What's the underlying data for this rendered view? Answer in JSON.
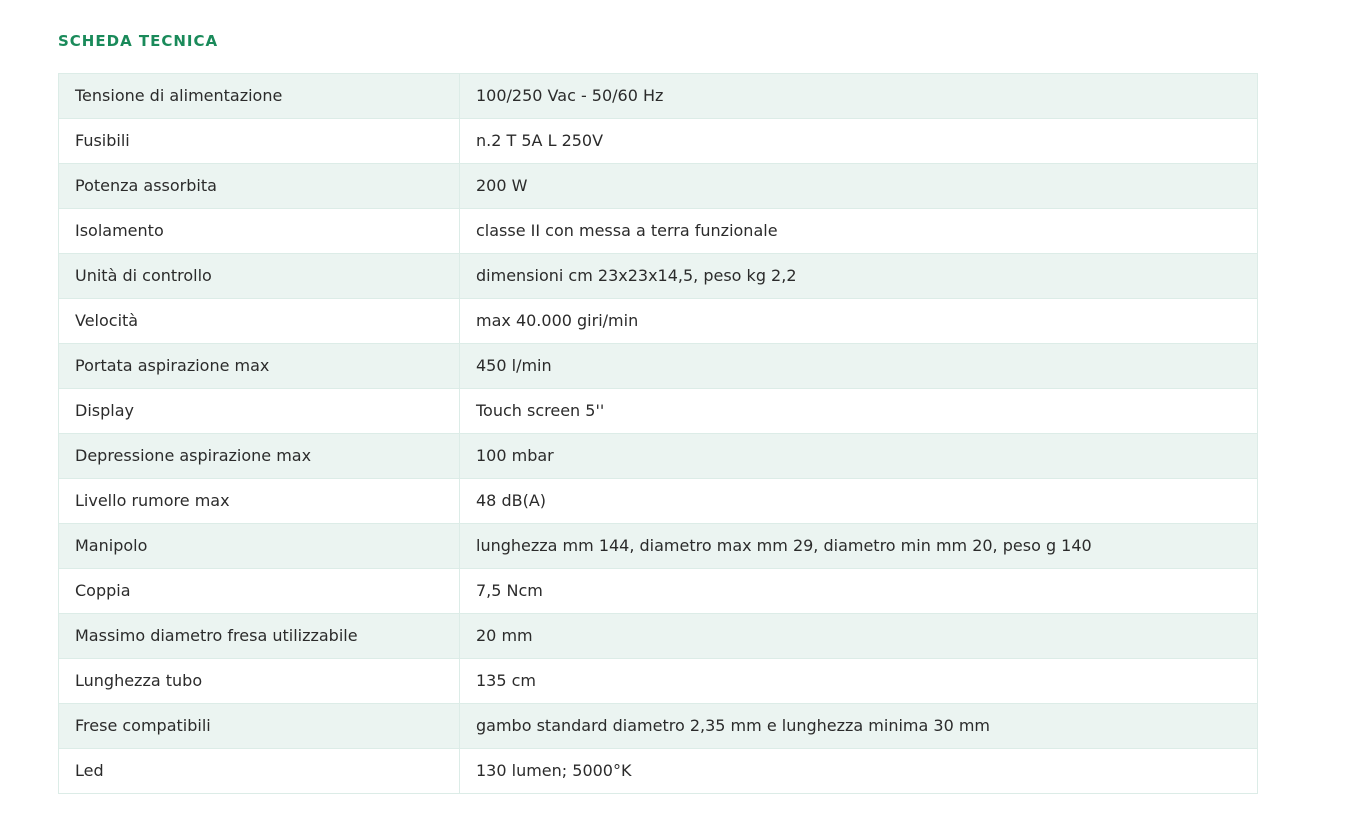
{
  "section": {
    "title": "SCHEDA TECNICA"
  },
  "specs": [
    {
      "label": "Tensione di alimentazione",
      "value": "100/250 Vac - 50/60 Hz"
    },
    {
      "label": "Fusibili",
      "value": "n.2 T 5A L 250V"
    },
    {
      "label": "Potenza assorbita",
      "value": "200 W"
    },
    {
      "label": "Isolamento",
      "value": "classe II con messa a terra funzionale"
    },
    {
      "label": "Unità di controllo",
      "value": "dimensioni cm 23x23x14,5, peso kg 2,2"
    },
    {
      "label": "Velocità",
      "value": "max 40.000 giri/min"
    },
    {
      "label": "Portata aspirazione max",
      "value": "450 l/min"
    },
    {
      "label": "Display",
      "value": "Touch screen 5''"
    },
    {
      "label": "Depressione aspirazione max",
      "value": "100 mbar"
    },
    {
      "label": "Livello rumore max",
      "value": "48 dB(A)"
    },
    {
      "label": "Manipolo",
      "value": "lunghezza mm 144, diametro max mm 29, diametro min mm 20, peso g 140"
    },
    {
      "label": "Coppia",
      "value": "7,5 Ncm"
    },
    {
      "label": "Massimo diametro fresa utilizzabile",
      "value": "20 mm"
    },
    {
      "label": "Lunghezza tubo",
      "value": "135 cm"
    },
    {
      "label": "Frese compatibili",
      "value": "gambo standard diametro 2,35 mm e lunghezza minima 30 mm"
    },
    {
      "label": "Led",
      "value": "130 lumen; 5000°K"
    }
  ],
  "colors": {
    "title": "#1a8a5a",
    "row_alt": "#ebf4f1",
    "border": "#dcece7",
    "text": "#2b2b2b"
  }
}
